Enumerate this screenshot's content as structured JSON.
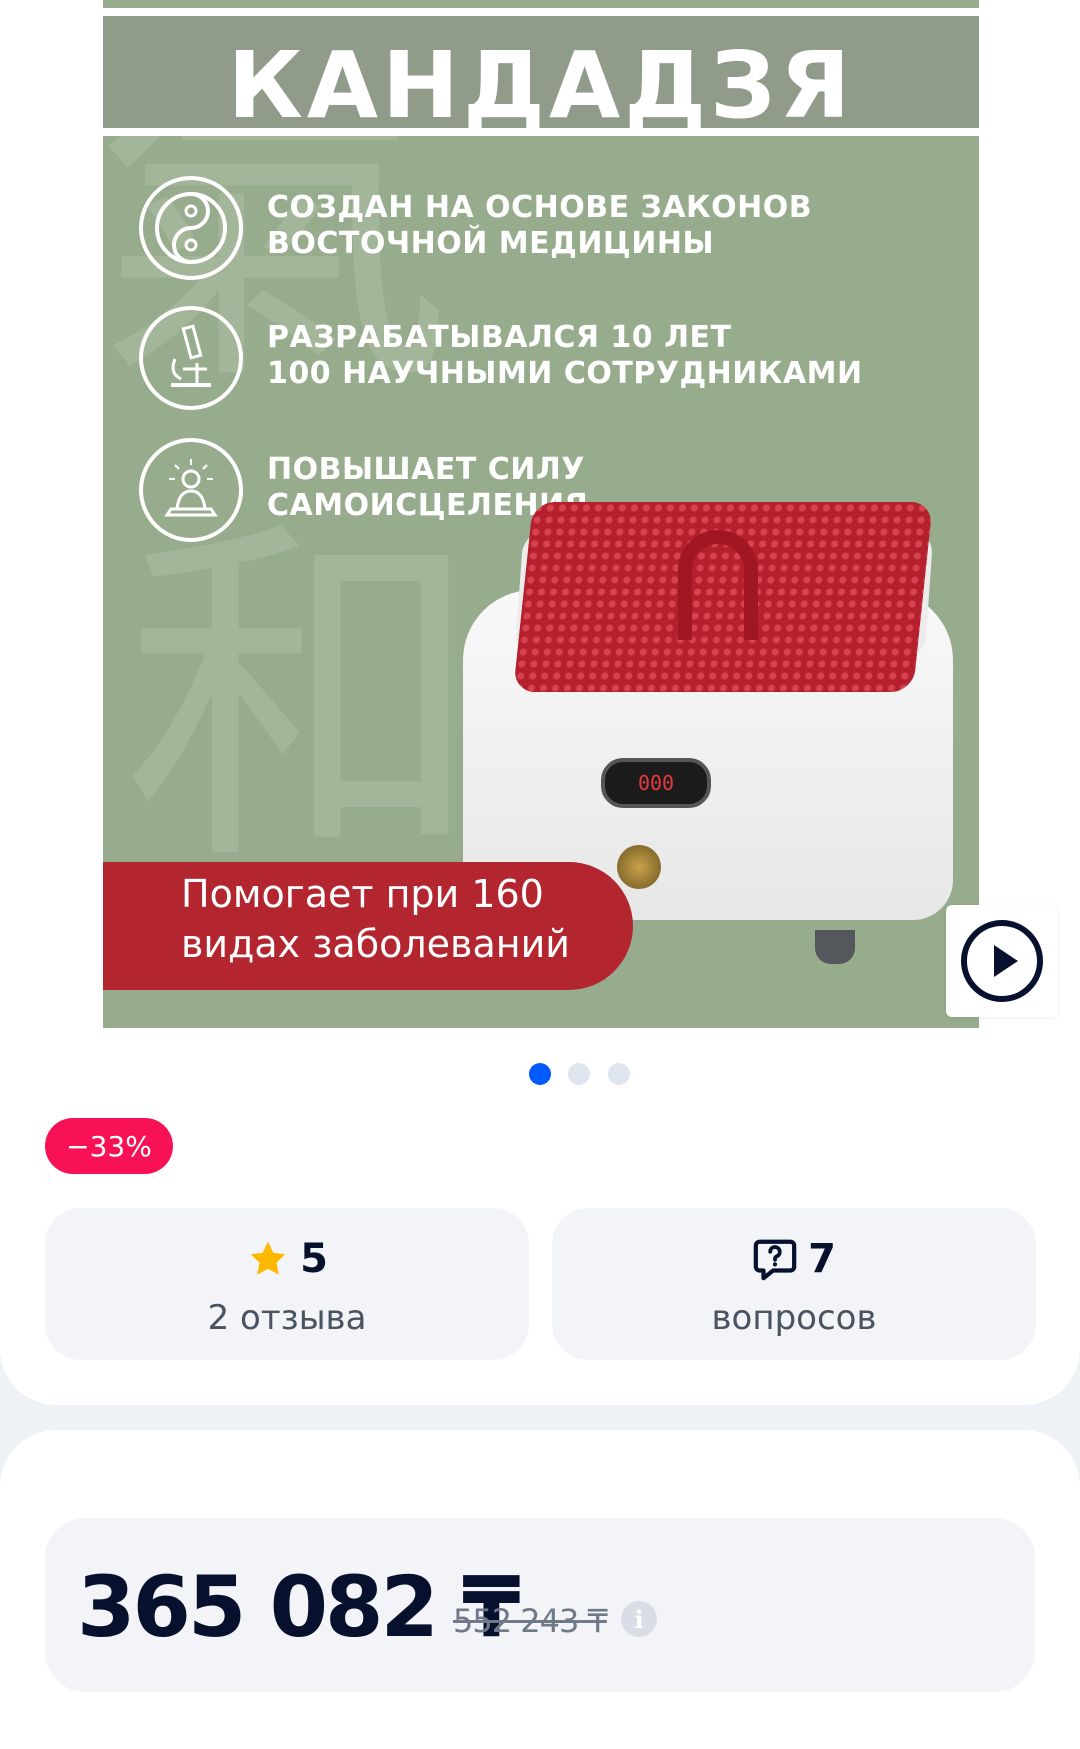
{
  "product_image": {
    "title": "КАНДАДЗЯ",
    "features": [
      {
        "icon": "yin-yang-icon",
        "text": "СОЗДАН НА ОСНОВЕ ЗАКОНОВ\nВОСТОЧНОЙ МЕДИЦИНЫ"
      },
      {
        "icon": "microscope-icon",
        "text": "РАЗРАБАТЫВАЛСЯ 10 ЛЕТ\n100 НАУЧНЫМИ СОТРУДНИКАМИ"
      },
      {
        "icon": "meditation-icon",
        "text": "ПОВЫШАЕТ СИЛУ\nСАМОИСЦЕЛЕНИЯ"
      }
    ],
    "banner_line1": "Помогает при 160",
    "banner_line2": "видах заболеваний",
    "display_digits": "000"
  },
  "carousel": {
    "count": 3,
    "active_index": 0
  },
  "discount_badge": "−33%",
  "rating": {
    "value": "5",
    "label": "2 отзыва"
  },
  "questions": {
    "value": "7",
    "label": "вопросов"
  },
  "price": {
    "current": "365 082 ₸",
    "old": "552 243 ₸"
  },
  "colors": {
    "accent": "#005bff",
    "discount": "#f91155",
    "banner": "#b3262f",
    "star": "#ffb800"
  }
}
